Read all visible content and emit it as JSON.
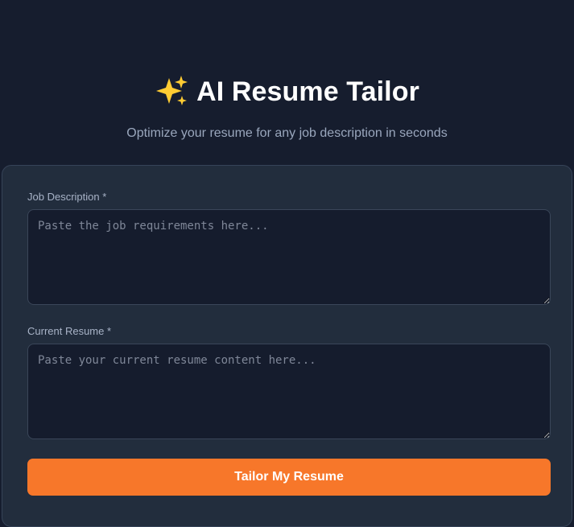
{
  "header": {
    "title": "AI Resume Tailor",
    "subtitle": "Optimize your resume for any job description in seconds",
    "icon": "sparkle-icon"
  },
  "form": {
    "job_description": {
      "label": "Job Description *",
      "placeholder": "Paste the job requirements here...",
      "value": ""
    },
    "current_resume": {
      "label": "Current Resume *",
      "placeholder": "Paste your current resume content here...",
      "value": ""
    },
    "submit_label": "Tailor My Resume"
  },
  "colors": {
    "background": "#161d2e",
    "card": "#222d3d",
    "input": "#151c2d",
    "accent": "#f7772a",
    "sparkle": "#ffcc33"
  }
}
